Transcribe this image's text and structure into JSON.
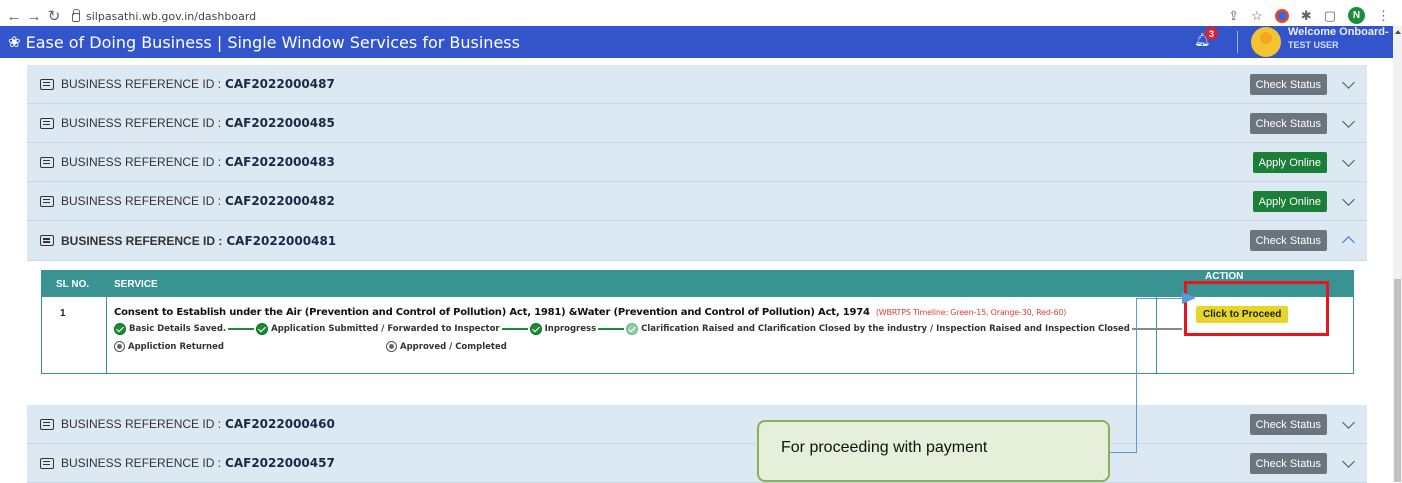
{
  "browser": {
    "url": "silpasathi.wb.gov.in/dashboard",
    "profile_initial": "N"
  },
  "header": {
    "title": "Ease of Doing Business | Single Window Services for Business",
    "notification_count": "3",
    "welcome": "Welcome Onboard-",
    "user": "TEST USER"
  },
  "labels": {
    "business_ref": "BUSINESS REFERENCE ID :"
  },
  "rows": [
    {
      "ref": "CAF2022000487",
      "button": "Check Status"
    },
    {
      "ref": "CAF2022000485",
      "button": "Check Status"
    },
    {
      "ref": "CAF2022000483",
      "button": "Apply Online"
    },
    {
      "ref": "CAF2022000482",
      "button": "Apply Online"
    },
    {
      "ref": "CAF2022000481",
      "button": "Check Status"
    },
    {
      "ref": "CAF2022000460",
      "button": "Check Status"
    },
    {
      "ref": "CAF2022000457",
      "button": "Check Status"
    }
  ],
  "table": {
    "headers": {
      "sl": "SL NO.",
      "service": "SERVICE",
      "action": "ACTION"
    },
    "row": {
      "sl": "1",
      "service": "Consent to Establish under the Air (Prevention and Control of Pollution) Act, 1981) &Water (Prevention and Control of Pollution) Act, 1974",
      "timeline": "(WBRTPS Timeline: Green-15, Orange-30, Red-60)",
      "action": "Click to Proceed",
      "steps": {
        "s1": "Basic Details Saved.",
        "s2": "Application Submitted / Forwarded to Inspector",
        "s3": "Inprogress",
        "s4": "Clarification Raised and Clarification Closed by the industry / Inspection Raised and Inspection Closed",
        "s5": "Appliction Returned",
        "s6": "Approved / Completed"
      }
    }
  },
  "annotation": {
    "callout": "For proceeding with payment"
  },
  "colors": {
    "header_bg": "#3355cc",
    "row_bg": "#dce8f2",
    "table_head": "#3a9393",
    "apply_btn": "#1b7f3a",
    "status_btn": "#6c757d",
    "proceed_btn": "#e7d52a",
    "highlight": "#e8141e"
  }
}
